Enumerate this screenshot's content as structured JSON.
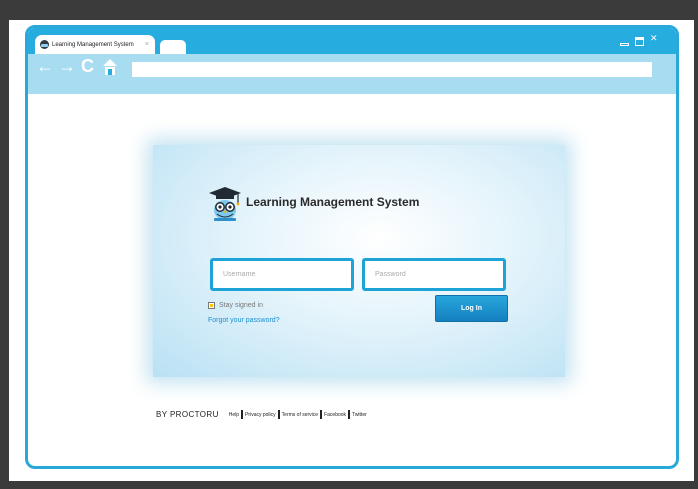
{
  "browser": {
    "tab_title": "Learning Management System",
    "tab_close": "×",
    "url": "",
    "nav": {
      "back_glyph": "←",
      "forward_glyph": "→",
      "reload_glyph": "C",
      "home_glyph": "🏠"
    },
    "window_controls": {
      "close_glyph": "✕"
    },
    "colors": {
      "chrome_top": "#27ace0",
      "chrome_bottom": "#a7dcf1",
      "border": "#29a9d9"
    }
  },
  "login": {
    "app_title": "Learning Management System",
    "logo_icon": "owl-graduate-icon",
    "username_placeholder": "Username",
    "password_placeholder": "Password",
    "stay_signed_in": "Stay signed in",
    "forgot_password": "Forgot your password?",
    "login_button": "Log In",
    "colors": {
      "accent": "#1ea3d6",
      "button": "#1a8fcd",
      "link": "#1a8fd0"
    }
  },
  "footer": {
    "brand": "BY PROCTORU",
    "links": [
      "Help",
      "Privacy policy",
      "Terms of service",
      "Facebook",
      "Twitter"
    ]
  }
}
